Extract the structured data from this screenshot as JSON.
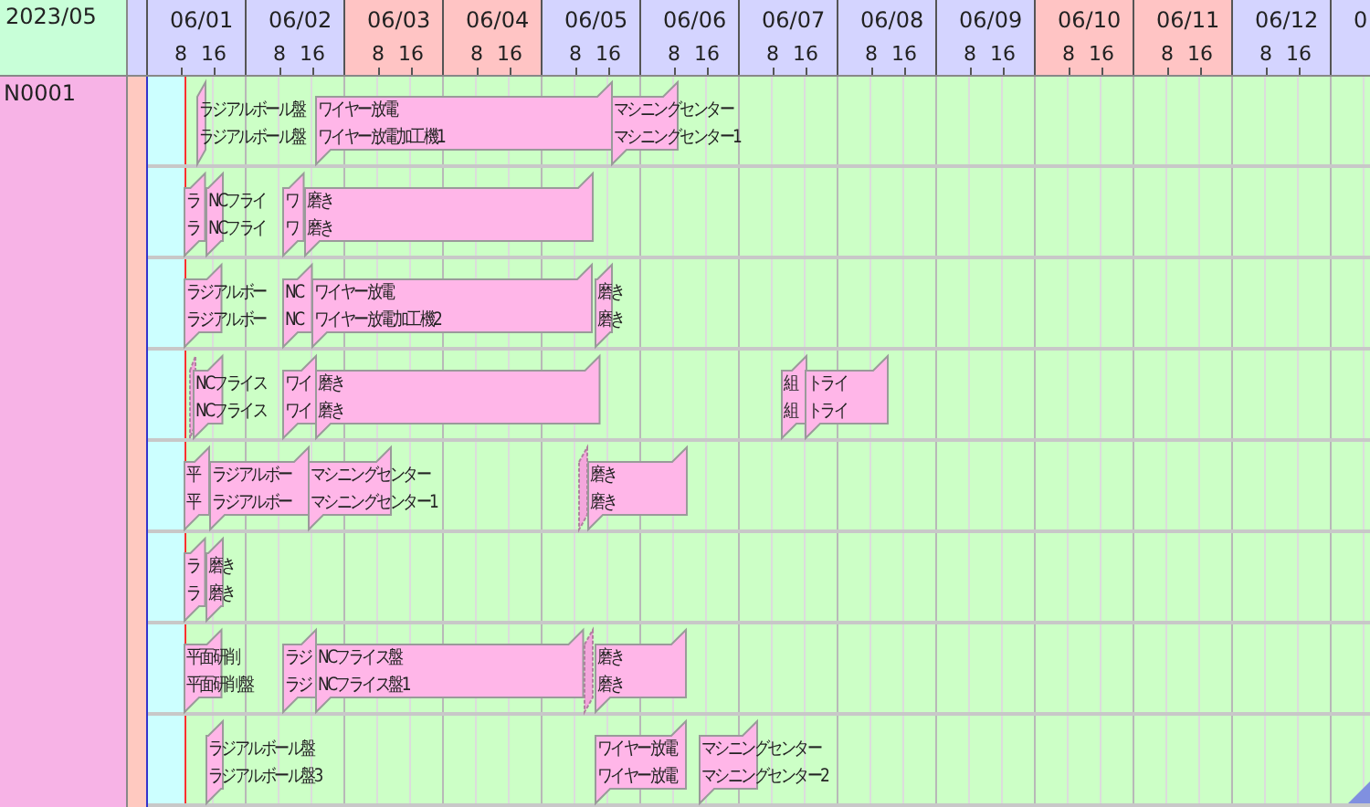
{
  "header": {
    "month": "2023/05",
    "days": [
      {
        "label": "06/01",
        "holiday": false,
        "ticks": [
          "8",
          "16"
        ]
      },
      {
        "label": "06/02",
        "holiday": false,
        "ticks": [
          "8",
          "16"
        ]
      },
      {
        "label": "06/03",
        "holiday": true,
        "ticks": [
          "8",
          "16"
        ]
      },
      {
        "label": "06/04",
        "holiday": true,
        "ticks": [
          "8",
          "16"
        ]
      },
      {
        "label": "06/05",
        "holiday": false,
        "ticks": [
          "8",
          "16"
        ]
      },
      {
        "label": "06/06",
        "holiday": false,
        "ticks": [
          "8",
          "16"
        ]
      },
      {
        "label": "06/07",
        "holiday": false,
        "ticks": [
          "8",
          "16"
        ]
      },
      {
        "label": "06/08",
        "holiday": false,
        "ticks": [
          "8",
          "16"
        ]
      },
      {
        "label": "06/09",
        "holiday": false,
        "ticks": [
          "8",
          "16"
        ]
      },
      {
        "label": "06/10",
        "holiday": true,
        "ticks": [
          "8",
          "16"
        ]
      },
      {
        "label": "06/11",
        "holiday": true,
        "ticks": [
          "8",
          "16"
        ]
      },
      {
        "label": "06/12",
        "holiday": false,
        "ticks": [
          "8",
          "16"
        ]
      },
      {
        "label": "0",
        "holiday": false
      }
    ]
  },
  "resource": {
    "name": "N0001"
  },
  "rows": [
    {
      "bars": [
        {
          "lines": [
            "ラジアルボール盤",
            "ラジアルボール盤"
          ]
        },
        {
          "lines": [
            "ワイヤー放電",
            "ワイヤー放電加工機1"
          ]
        },
        {
          "lines": [
            "マシニングセンター",
            "マシニングセンター1"
          ]
        }
      ]
    },
    {
      "bars": [
        {
          "lines": [
            "ラ",
            "ラ"
          ]
        },
        {
          "lines": [
            "NCフライ",
            "NCフライ"
          ]
        },
        {
          "lines": [
            "ワ",
            "ワ"
          ]
        },
        {
          "lines": [
            "磨き",
            "磨き"
          ]
        }
      ]
    },
    {
      "bars": [
        {
          "lines": [
            "ラジアルボー",
            "ラジアルボー"
          ]
        },
        {
          "lines": [
            "NC",
            "NC"
          ]
        },
        {
          "lines": [
            "ワイヤー放電",
            "ワイヤー放電加工機2"
          ]
        },
        {
          "lines": [
            "磨き",
            "磨き"
          ]
        }
      ]
    },
    {
      "bars": [
        {
          "kind": "sliver"
        },
        {
          "lines": [
            "NCフライス",
            "NCフライス"
          ]
        },
        {
          "lines": [
            "ワイ",
            "ワイ"
          ]
        },
        {
          "lines": [
            "磨き",
            "磨き"
          ]
        },
        {
          "lines": [
            "組",
            "組"
          ]
        },
        {
          "lines": [
            "トライ",
            "トライ"
          ]
        }
      ]
    },
    {
      "bars": [
        {
          "lines": [
            "平",
            "平"
          ]
        },
        {
          "lines": [
            "ラジアルボー",
            "ラジアルボー"
          ]
        },
        {
          "lines": [
            "マシニングセンター",
            "マシニングセンター1"
          ]
        },
        {
          "kind": "sliver"
        },
        {
          "lines": [
            "磨き",
            "磨き"
          ]
        }
      ]
    },
    {
      "bars": [
        {
          "lines": [
            "ラ",
            "ラ"
          ]
        },
        {
          "lines": [
            "磨き",
            "磨き"
          ]
        }
      ]
    },
    {
      "bars": [
        {
          "lines": [
            "平面研削",
            "平面研削盤"
          ]
        },
        {
          "lines": [
            "ラジ",
            "ラジ"
          ]
        },
        {
          "lines": [
            "NCフライス盤",
            "NCフライス盤1"
          ]
        },
        {
          "kind": "sliver"
        },
        {
          "lines": [
            "磨き",
            "磨き"
          ]
        }
      ]
    },
    {
      "bars": [
        {
          "lines": [
            "ラジアルボール盤",
            "ラジアルボール盤3"
          ]
        },
        {
          "lines": [
            "ワイヤー放電",
            "ワイヤー放電"
          ]
        },
        {
          "lines": [
            "マシニングセンター",
            "マシニングセンター2"
          ]
        }
      ]
    }
  ]
}
